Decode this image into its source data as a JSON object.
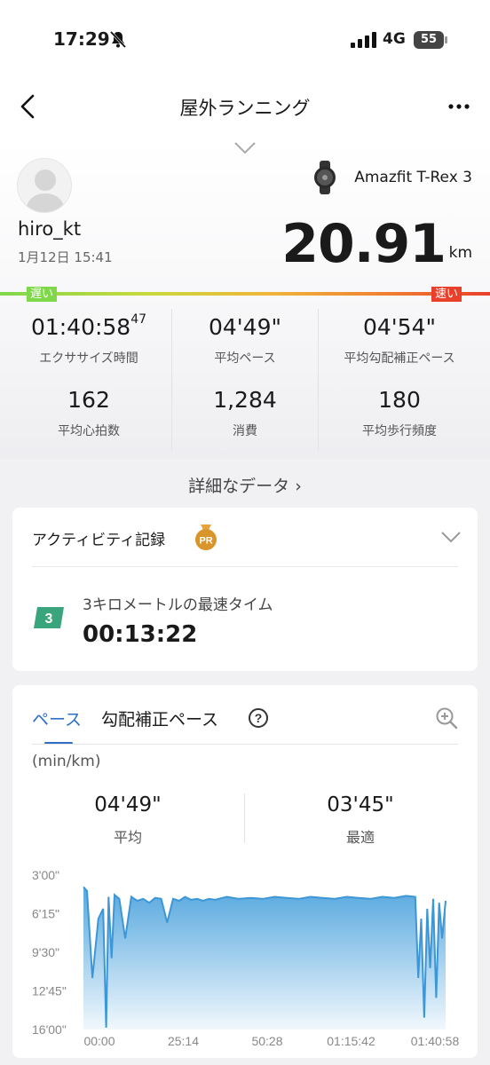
{
  "status": {
    "time": "17:29",
    "network": "4G",
    "battery": "55"
  },
  "nav": {
    "title": "屋外ランニング"
  },
  "summary": {
    "username": "hiro_kt",
    "datetime": "1月12日 15:41",
    "device": "Amazfit T-Rex 3",
    "distance": "20.91",
    "distance_unit": "km",
    "slow_label": "遅い",
    "fast_label": "速い",
    "stats": [
      {
        "value": "01:40:58",
        "value_sup": "47",
        "label": "エクササイズ時間"
      },
      {
        "value": "04'49\"",
        "label": "平均ペース"
      },
      {
        "value": "04'54\"",
        "label": "平均勾配補正ペース"
      },
      {
        "value": "162",
        "label": "平均心拍数"
      },
      {
        "value": "1,284",
        "label": "消費"
      },
      {
        "value": "180",
        "label": "平均歩行頻度"
      }
    ],
    "details_link": "詳細なデータ ›"
  },
  "activity": {
    "title": "アクティビティ記録",
    "pr_badge": "PR",
    "rank": "3",
    "record_label": "3キロメートルの最速タイム",
    "record_value": "00:13:22"
  },
  "pace_chart": {
    "tabs": [
      "ペース",
      "勾配補正ペース"
    ],
    "active_tab": "ペース",
    "unit": "(min/km)",
    "avg_value": "04'49\"",
    "avg_label": "平均",
    "best_value": "03'45\"",
    "best_label": "最適",
    "accent_color": "#2e6fc4",
    "fill_color": "#4da3dd"
  },
  "chart_data": {
    "type": "area",
    "title": "",
    "xlabel": "",
    "ylabel": "(min/km)",
    "x_ticks": [
      "00:00",
      "25:14",
      "50:28",
      "01:15:42",
      "01:40:58"
    ],
    "y_ticks": [
      "3'00\"",
      "6'15\"",
      "9'30\"",
      "12'45\"",
      "16'00\""
    ],
    "y_range_seconds": [
      180,
      960
    ],
    "y_inverted": true,
    "x_range_seconds": [
      0,
      6058
    ],
    "series": [
      {
        "x_seconds": [
          0,
          60,
          150,
          250,
          330,
          380,
          420,
          470,
          520,
          600,
          700,
          800,
          900,
          1000,
          1100,
          1200,
          1300,
          1400,
          1500,
          1600,
          1700,
          1800,
          1900,
          2000,
          2100,
          2200,
          2400,
          2600,
          2800,
          3000,
          3200,
          3400,
          3600,
          3800,
          4000,
          4200,
          4400,
          4600,
          4800,
          5000,
          5200,
          5400,
          5550,
          5600,
          5650,
          5700,
          5750,
          5800,
          5850,
          5900,
          5950,
          6000,
          6058
        ],
        "pace_seconds": [
          240,
          260,
          700,
          400,
          350,
          950,
          290,
          600,
          280,
          300,
          500,
          290,
          310,
          300,
          320,
          295,
          300,
          420,
          300,
          310,
          290,
          305,
          300,
          310,
          300,
          305,
          290,
          300,
          295,
          300,
          290,
          295,
          300,
          290,
          295,
          300,
          290,
          295,
          300,
          290,
          295,
          285,
          290,
          700,
          400,
          900,
          350,
          650,
          300,
          800,
          320,
          500,
          310
        ]
      }
    ]
  }
}
